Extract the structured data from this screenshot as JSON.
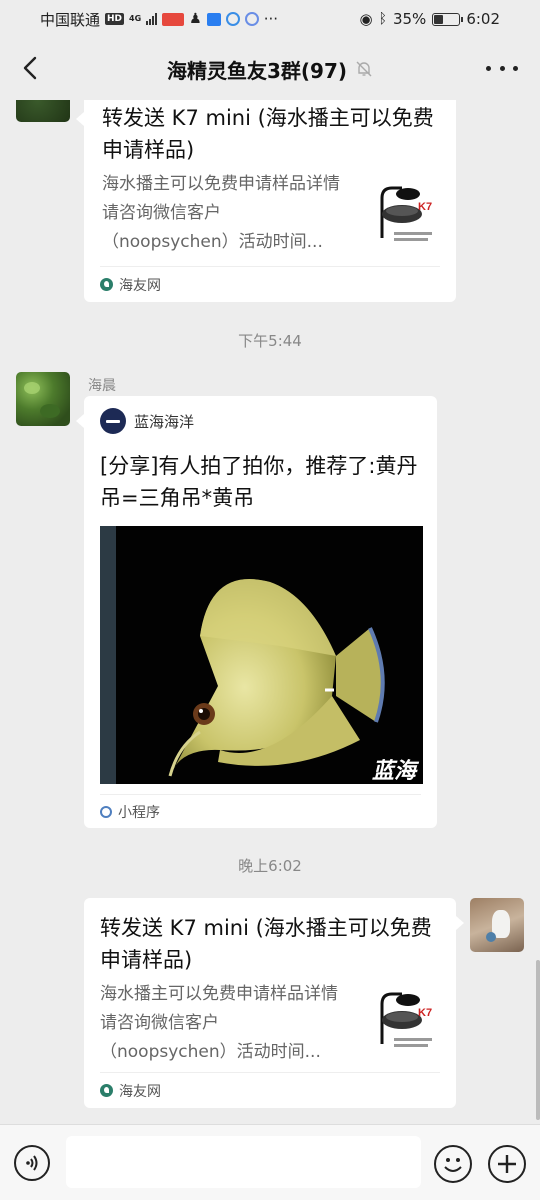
{
  "status_bar": {
    "carrier": "中国联通",
    "hd": "HD",
    "network": "4G",
    "battery_percent": "35%",
    "battery_level": 0.35,
    "time": "6:02"
  },
  "header": {
    "title": "海精灵鱼友3群(97)",
    "icons": [
      "back-arrow-icon",
      "mute-bell-icon",
      "more-icon"
    ]
  },
  "messages": [
    {
      "type": "link_card",
      "title": "转发送 K7 mini (海水播主可以免费申请样品)",
      "description": "海水播主可以免费申请样品详情请咨询微信客户（noopsychen）活动时间...",
      "source": "海友网"
    },
    {
      "type": "timestamp",
      "text": "下午5:44"
    },
    {
      "type": "mini_program",
      "sender": "海晨",
      "app_name": "蓝海海洋",
      "title": "[分享]有人拍了拍你，推荐了:黄丹吊=三角吊*黄吊",
      "image_watermark": "蓝海",
      "footer": "小程序"
    },
    {
      "type": "timestamp",
      "text": "晚上6:02"
    },
    {
      "type": "link_card",
      "title": "转发送 K7 mini (海水播主可以免费申请样品)",
      "description": "海水播主可以免费申请样品详情请咨询微信客户（noopsychen）活动时间...",
      "source": "海友网"
    }
  ],
  "input_bar": {
    "placeholder": "",
    "icons": [
      "voice-icon",
      "emoji-icon",
      "plus-icon"
    ]
  },
  "colors": {
    "background": "#ededed",
    "bubble": "#ffffff",
    "muted_text": "#888888"
  }
}
